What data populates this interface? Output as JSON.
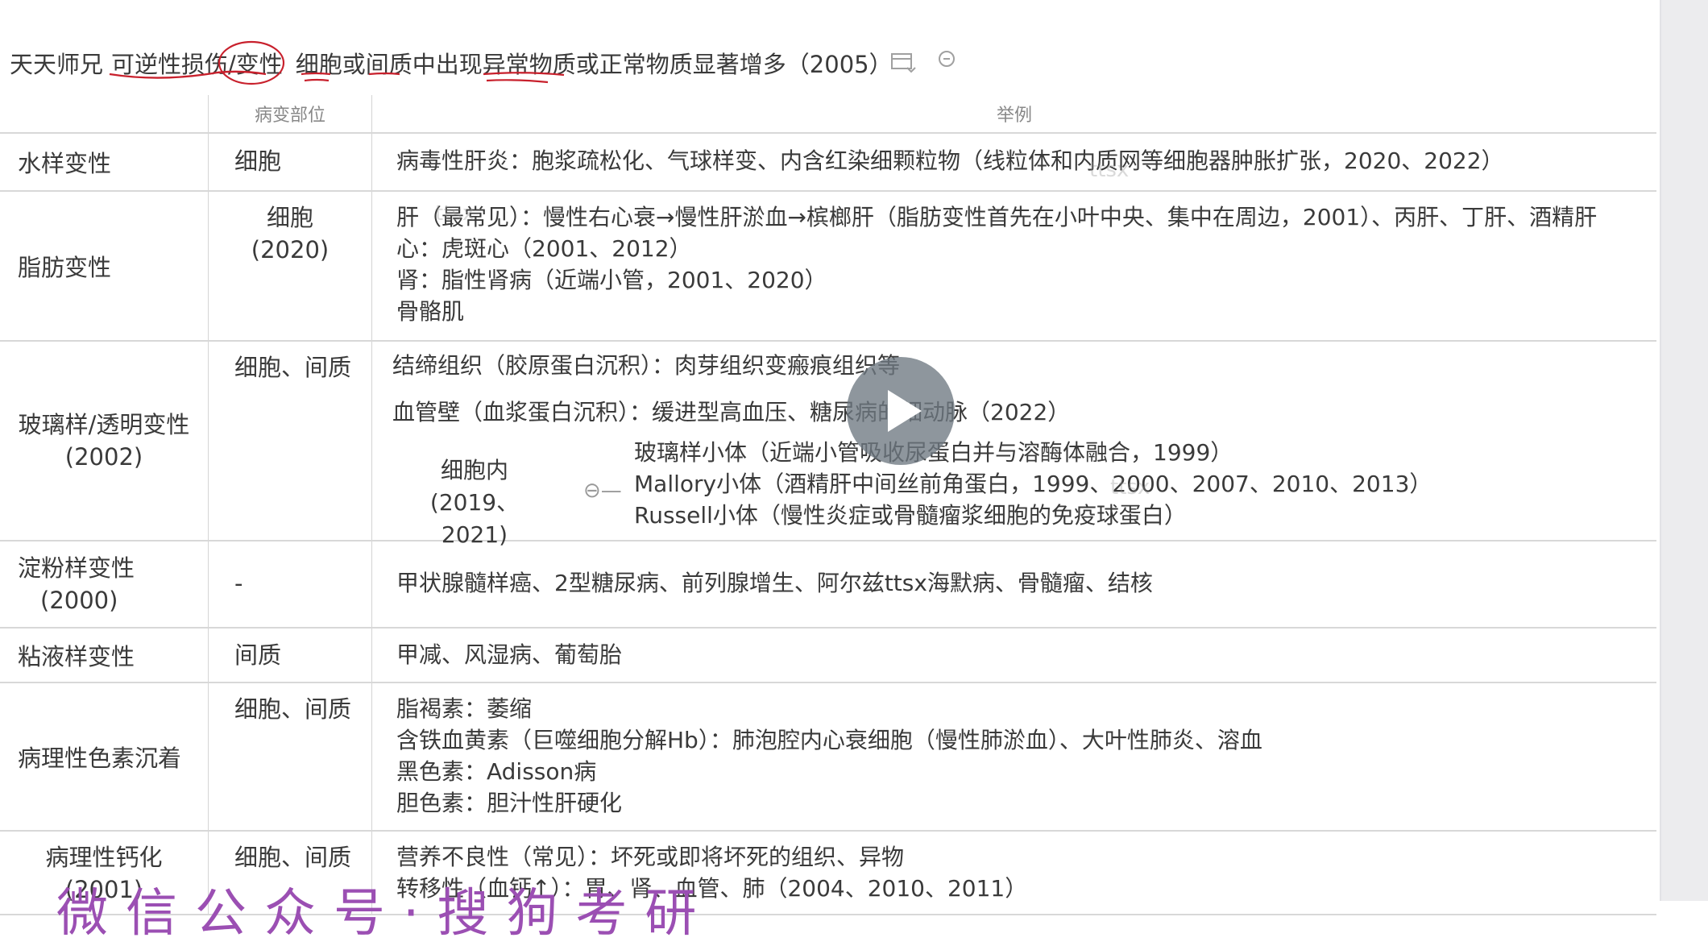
{
  "header": {
    "segments": [
      "天天师兄",
      "可逆性损伤/变性",
      "细胞或间质中出现异常物质或正常物质显著增多（2005）"
    ]
  },
  "table": {
    "columns": [
      "",
      "病变部位",
      "举例"
    ],
    "rows": [
      {
        "label": "水样变性",
        "site": "细胞",
        "examples": [
          "病毒性肝炎：胞浆疏松化、气球样变、内含红染细颗粒物（线粒体和内质网等细胞器肿胀扩张，2020、2022）"
        ]
      },
      {
        "label": "脂肪变性",
        "site": [
          "细胞",
          "(2020)"
        ],
        "examples": [
          "肝（最常见）：慢性右心衰→慢性肝淤血→槟榔肝（脂肪变性首先在小叶中央、集中在周边，2001）、丙肝、丁肝、酒精肝",
          "心：虎斑心（2001、2012）",
          "肾：脂性肾病（近端小管，2001、2020）",
          "骨骼肌"
        ]
      },
      {
        "label": [
          "玻璃样/透明变性",
          "(2002)"
        ],
        "site": "细胞、间质",
        "examples": [
          "结缔组织（胶原蛋白沉积）：肉芽组织变瘢痕组织等",
          "血管壁（血浆蛋白沉积）：缓进型高血压、糖尿病的细动脉（2022）"
        ],
        "intracell": {
          "label": [
            "细胞内",
            "(2019、2021)"
          ],
          "items": [
            "玻璃样小体（近端小管吸收尿蛋白并与溶酶体融合，1999）",
            "Mallory小体（酒精肝中间丝前角蛋白，1999、2000、2007、2010、2013）",
            "Russell小体（慢性炎症或骨髓瘤浆细胞的免疫球蛋白）"
          ]
        }
      },
      {
        "label": [
          "淀粉样变性",
          "(2000)"
        ],
        "site": "-",
        "examples": [
          "甲状腺髓样癌、2型糖尿病、前列腺增生、阿尔兹ttsx海默病、骨髓瘤、结核"
        ]
      },
      {
        "label": "粘液样变性",
        "site": "间质",
        "examples": [
          "甲减、风湿病、葡萄胎"
        ]
      },
      {
        "label": "病理性色素沉着",
        "site": "细胞、间质",
        "examples": [
          "脂褐素：萎缩",
          "含铁血黄素（巨噬细胞分解Hb）：肺泡腔内心衰细胞（慢性肺淤血）、大叶性肺炎、溶血",
          "黑色素：Adisson病",
          "胆色素：胆汁性肝硬化"
        ]
      },
      {
        "label": [
          "病理性钙化",
          "(2001)"
        ],
        "site": "细胞、间质",
        "examples": [
          "营养不良性（常见）：坏死或即将坏死的组织、异物",
          "转移性（血钙↑）：胃、肾、血管、肺（2004、2010、2011）"
        ]
      }
    ]
  },
  "watermark": {
    "text": "ttsx",
    "bottom": "微信公众号·搜狗考研"
  },
  "colors": {
    "annotation": "#c8202c",
    "bottom_watermark": "#9b4fb3",
    "play_button": "#6e7882"
  }
}
